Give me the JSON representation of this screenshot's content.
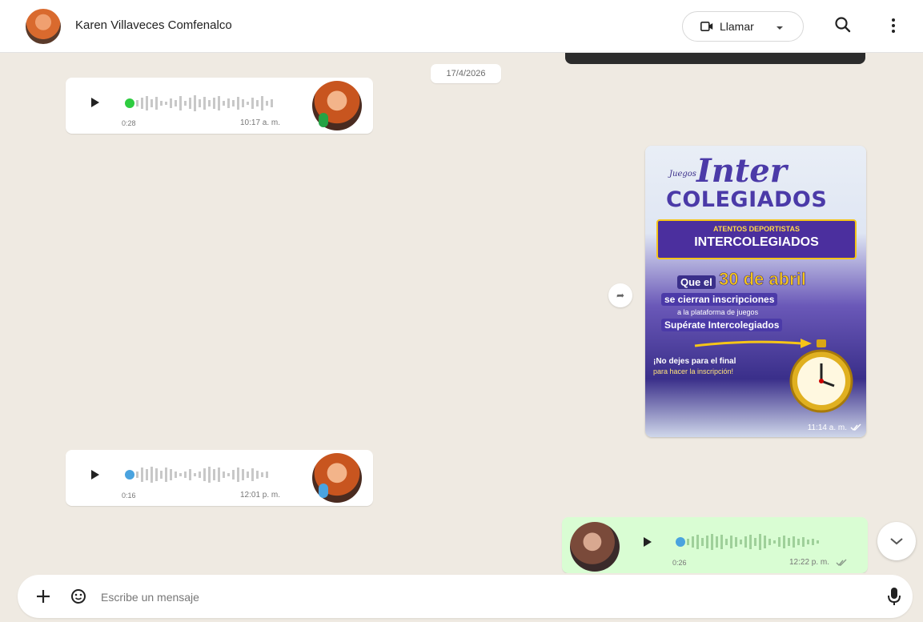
{
  "header": {
    "contact_name": "Karen Villaveces Comfenalco",
    "call_label": "Llamar"
  },
  "chat": {
    "date_separator": "17/4/2026",
    "messages": [
      {
        "type": "voice",
        "direction": "incoming",
        "duration": "0:28",
        "time": "10:17 a. m.",
        "dot_color": "#2ecc40"
      },
      {
        "type": "image",
        "direction": "outgoing",
        "time": "11:14 a. m.",
        "poster": {
          "brand": "Juegos",
          "title_line1": "Inter",
          "title_line2": "COLEGIADOS",
          "banner_line1": "ATENTOS DEPORTISTAS",
          "banner_line2": "INTERCOLEGIADOS",
          "body_line1_pre": "Que el",
          "body_line1_big": "30 de abril",
          "body_line2": "se cierran inscripciones",
          "body_line3": "a la plataforma de juegos",
          "body_line4": "Supérate Intercolegiados",
          "footer_line1": "¡No dejes para el final",
          "footer_line2": "para hacer la inscripción!"
        }
      },
      {
        "type": "voice",
        "direction": "incoming",
        "duration": "0:16",
        "time": "12:01 p. m.",
        "dot_color": "#4aa3df"
      },
      {
        "type": "voice",
        "direction": "outgoing",
        "duration": "0:26",
        "time": "12:22 p. m.",
        "dot_color": "#4aa3df"
      }
    ]
  },
  "composer": {
    "placeholder": "Escribe un mensaje"
  },
  "colors": {
    "chat_background": "#efeae2",
    "outgoing_bubble": "#d9fdd3",
    "incoming_bubble": "#ffffff",
    "poster_purple": "#3a2f8a",
    "poster_yellow": "#f5c518"
  },
  "icons": [
    "video-call-icon",
    "chevron-down-icon",
    "search-icon",
    "kebab-menu-icon",
    "play-icon",
    "mic-icon",
    "forward-icon",
    "plus-icon",
    "sticker-icon"
  ]
}
